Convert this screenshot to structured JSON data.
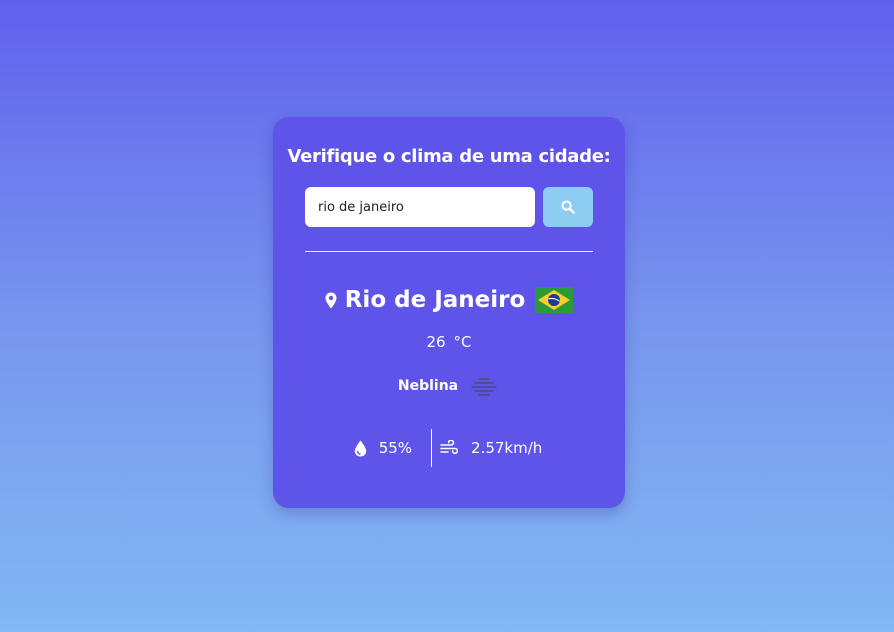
{
  "form": {
    "title": "Verifique o clima de uma cidade:",
    "search_value": "rio de janeiro",
    "search_button_icon": "search-icon"
  },
  "weather": {
    "city": "Rio de Janeiro",
    "flag_icon": "brazil-flag-icon",
    "temperature": "26",
    "unit": "°C",
    "description": "Neblina",
    "description_icon": "mist-icon",
    "humidity": "55%",
    "humidity_icon": "droplet-icon",
    "wind": "2.57km/h",
    "wind_icon": "wind-icon"
  },
  "colors": {
    "card": "#5e54ea",
    "search_button": "#8dcdf2",
    "background_top": "#6160ee",
    "background_bottom": "#82b8f3"
  }
}
